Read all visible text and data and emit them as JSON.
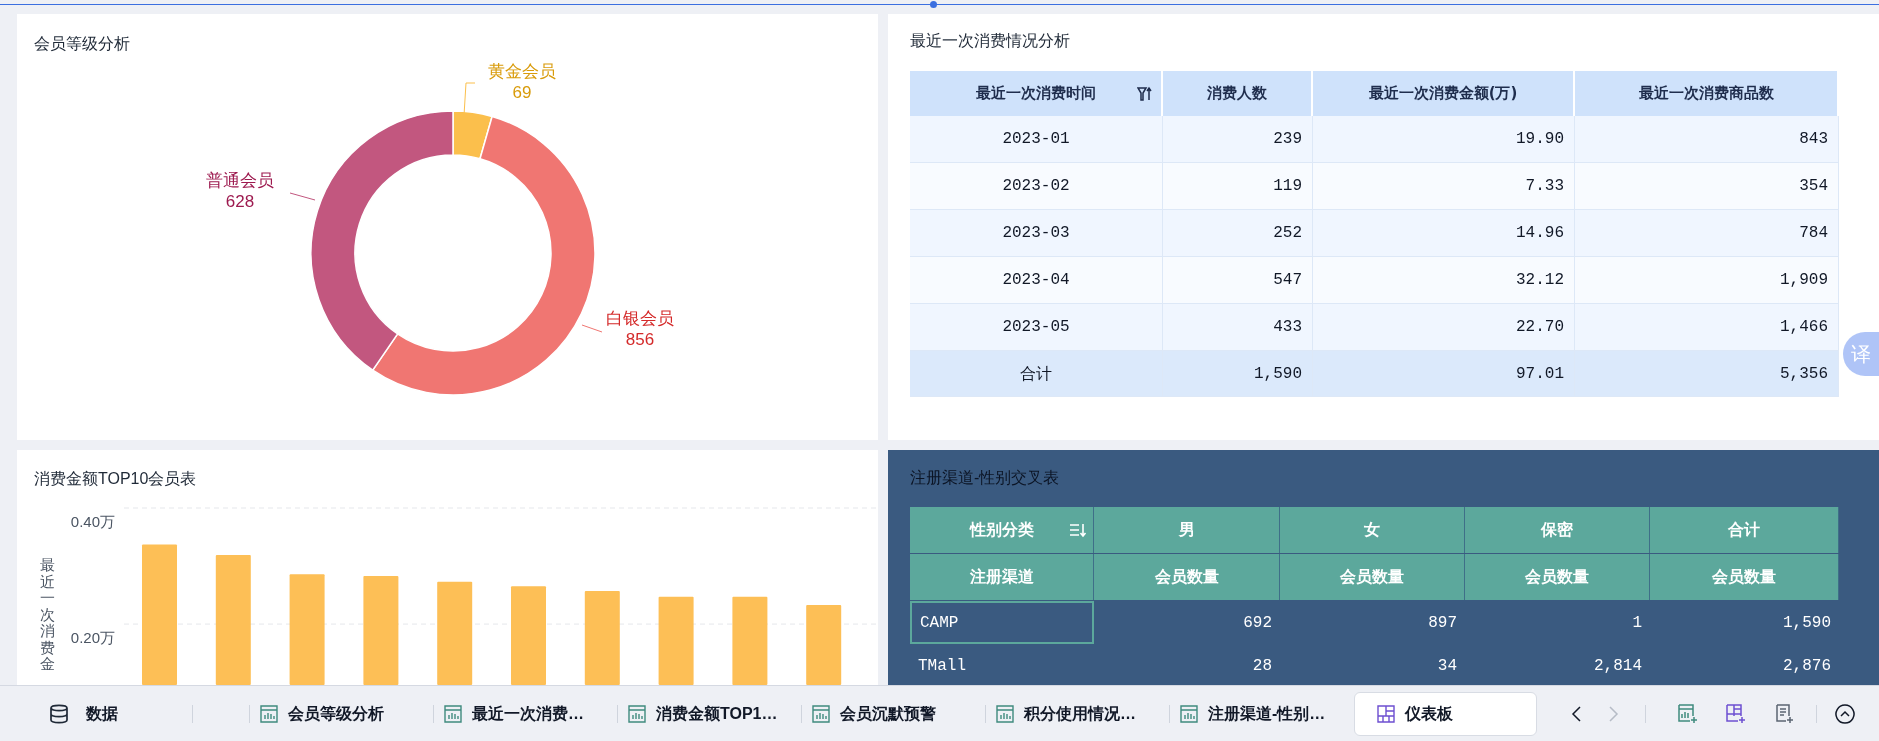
{
  "member_level": {
    "title": "会员等级分析",
    "chart_data": {
      "type": "donut",
      "categories": [
        "黄金会员",
        "白银会员",
        "普通会员"
      ],
      "values": [
        69,
        856,
        628
      ],
      "data_labels": true
    }
  },
  "recent_spend": {
    "title": "最近一次消费情况分析",
    "columns": [
      {
        "label": "最近一次消费时间",
        "sortable": true
      },
      {
        "label": "消费人数",
        "sortable": false
      },
      {
        "label": "最近一次消费金额(万)",
        "sortable": false
      },
      {
        "label": "最近一次消费商品数",
        "sortable": false
      }
    ],
    "rows": [
      [
        "2023-01",
        "239",
        "19.90",
        "843"
      ],
      [
        "2023-02",
        "119",
        "7.33",
        "354"
      ],
      [
        "2023-03",
        "252",
        "14.96",
        "784"
      ],
      [
        "2023-04",
        "547",
        "32.12",
        "1,909"
      ],
      [
        "2023-05",
        "433",
        "22.70",
        "1,466"
      ]
    ],
    "total": [
      "合计",
      "1,590",
      "97.01",
      "5,356"
    ]
  },
  "top10": {
    "title": "消费金额TOP10会员表",
    "chart_data": {
      "type": "bar",
      "ylabel": "最近一次消费金",
      "values": [
        0.337,
        0.319,
        0.286,
        0.283,
        0.273,
        0.265,
        0.257,
        0.247,
        0.247,
        0.233
      ],
      "ylim": [
        0.095,
        0.4
      ],
      "yticks": [
        {
          "value": 0.2,
          "label": "0.20万"
        },
        {
          "value": 0.4,
          "label": "0.40万"
        }
      ]
    }
  },
  "channel_gender": {
    "title": "注册渠道-性别交叉表",
    "header_rows": [
      [
        {
          "label": "性别分类",
          "sortable": true
        },
        {
          "label": "男",
          "sortable": false
        },
        {
          "label": "女",
          "sortable": false
        },
        {
          "label": "保密",
          "sortable": false
        },
        {
          "label": "合计",
          "sortable": false
        }
      ],
      [
        {
          "label": "注册渠道",
          "sortable": false
        },
        {
          "label": "会员数量",
          "sortable": false
        },
        {
          "label": "会员数量",
          "sortable": false
        },
        {
          "label": "会员数量",
          "sortable": false
        },
        {
          "label": "会员数量",
          "sortable": false
        }
      ]
    ],
    "rows": [
      {
        "cells": [
          "CAMP",
          "692",
          "897",
          "1",
          "1,590"
        ],
        "selected": true
      },
      {
        "cells": [
          "TMall",
          "28",
          "34",
          "2,814",
          "2,876"
        ],
        "selected": false
      }
    ]
  },
  "translate_button": {
    "label": "译"
  },
  "bottom_bar": {
    "data_button": {
      "label": "数据"
    },
    "tabs": [
      {
        "label": "会员等级分析",
        "kind": "chart",
        "selected": false
      },
      {
        "label": "最近一次消费…",
        "kind": "chart",
        "selected": false
      },
      {
        "label": "消费金额TOP1…",
        "kind": "chart",
        "selected": false
      },
      {
        "label": "会员沉默预警",
        "kind": "chart",
        "selected": false
      },
      {
        "label": "积分使用情况…",
        "kind": "chart",
        "selected": false
      },
      {
        "label": "注册渠道-性别…",
        "kind": "chart",
        "selected": false
      },
      {
        "label": "仪表板",
        "kind": "dashboard",
        "selected": true
      }
    ]
  }
}
